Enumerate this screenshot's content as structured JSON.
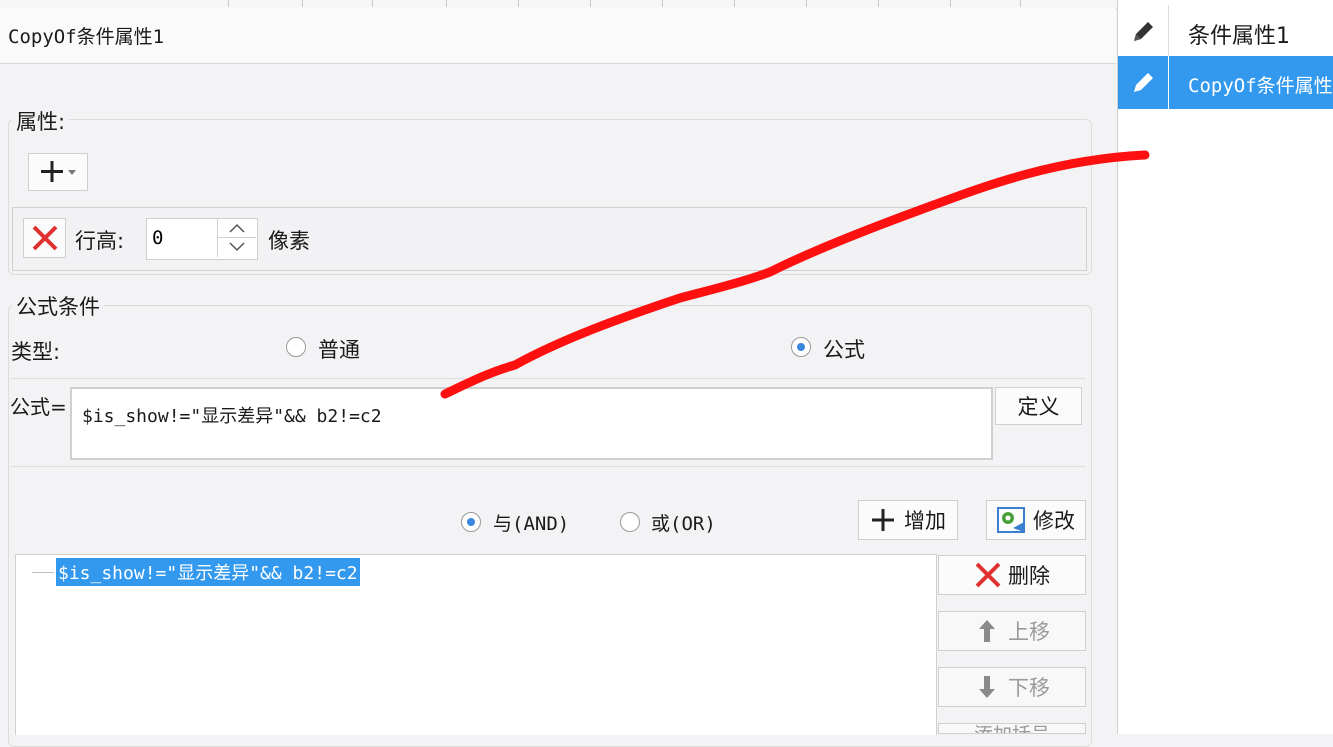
{
  "title_bar": {
    "title": "CopyOf条件属性1"
  },
  "right_panel": {
    "items": [
      {
        "label": "条件属性1",
        "icon": "pencil-icon",
        "selected": false
      },
      {
        "label": "CopyOf条件属性1",
        "icon": "pencil-icon",
        "selected": true
      }
    ]
  },
  "properties": {
    "legend": "属性:",
    "add_icon": "plus-icon",
    "row_height": {
      "label": "行高:",
      "value": "0",
      "unit": "像素"
    }
  },
  "formula_condition": {
    "legend": "公式条件",
    "type_label": "类型:",
    "type_options": [
      {
        "label": "普通",
        "checked": false
      },
      {
        "label": "公式",
        "checked": true
      }
    ],
    "formula_label": "公式=",
    "formula_value": "$is_show!=\"显示差异\"&& b2!=c2",
    "define_button": "定义",
    "logic_options": [
      {
        "label": "与(AND)",
        "checked": true
      },
      {
        "label": "或(OR)",
        "checked": false
      }
    ],
    "add_button": "增加",
    "modify_button": "修改",
    "conditions": [
      "$is_show!=\"显示差异\"&& b2!=c2"
    ],
    "delete_button": "删除",
    "move_up_button": "上移",
    "move_down_button": "下移",
    "bracket_button": "添加括号"
  },
  "colors": {
    "accent": "#3399ee",
    "annotation": "#ff1010",
    "delete": "#e03030"
  }
}
